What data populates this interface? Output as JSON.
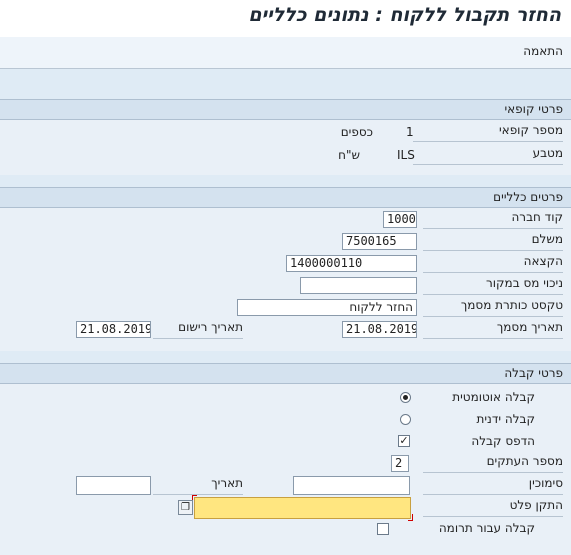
{
  "title": "החזר תקבול ללקוח : נתונים כלליים",
  "toolbar": {
    "match_label": "התאמה"
  },
  "cashier": {
    "header": "פרטי קופאי",
    "cashier_no_label": "מספר קופאי",
    "cashier_no_value": "1",
    "cashier_name": "כספים",
    "currency_label": "מטבע",
    "currency_code": "ILS",
    "currency_name": "ש\"ח"
  },
  "general": {
    "header": "פרטים כלליים",
    "company_code_label": "קוד חברה",
    "company_code": "1000",
    "payer_label": "משלם",
    "payer": "7500165",
    "allocation_label": "הקצאה",
    "allocation": "1400000110",
    "withholding_label": "ניכוי מס במקור",
    "withholding": "",
    "header_text_label": "טקסט כותרת מסמך",
    "header_text": "החזר ללקוח",
    "doc_date_label": "תאריך מסמך",
    "doc_date": "21.08.2019",
    "posting_date_label": "תאריך רישום",
    "posting_date": "21.08.2019"
  },
  "receipt": {
    "header": "פרטי קבלה",
    "auto_label": "קבלה אוטומטית",
    "auto_selected": true,
    "manual_label": "קבלה ידנית",
    "manual_selected": false,
    "print_label": "הדפס קבלה",
    "print_checked": true,
    "print_check_glyph": "✓",
    "copies_label": "מספר העתקים",
    "copies": "2",
    "reference_label": "סימוכין",
    "reference": "",
    "date_label": "תאריך",
    "date": "",
    "printer_label": "התקן פלט",
    "printer": "",
    "printer_help_glyph": "❐",
    "donation_label": "קבלה עבור תרומה",
    "donation_checked": false
  },
  "colors": {
    "printer_bg": "#ffe680",
    "required_corner": "#d00000"
  }
}
